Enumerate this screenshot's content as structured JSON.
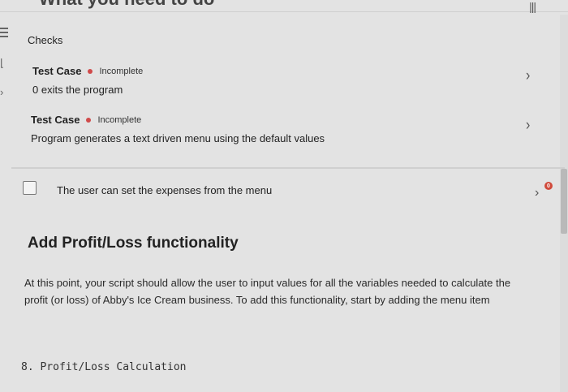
{
  "header": {
    "title": "What you need to do"
  },
  "checks": {
    "title": "Checks",
    "cases": [
      {
        "label": "Test Case",
        "status": "Incomplete",
        "description": "0 exits the program"
      },
      {
        "label": "Test Case",
        "status": "Incomplete",
        "description": "Program generates a text driven menu using the default values"
      }
    ]
  },
  "task": {
    "label": "The user can set the expenses from the menu",
    "badge": "0"
  },
  "section": {
    "title": "Add Profit/Loss functionality",
    "paragraph": "At this point, your script should allow the user to input values for all the variables needed to calculate the profit (or loss) of Abby's Ice Cream business. To add this functionality, start by adding the menu item"
  },
  "code": {
    "line": "8. Profit/Loss Calculation"
  },
  "colors": {
    "status_dot": "#d04a4a",
    "badge": "#d04a3b",
    "background": "#e3e3e3"
  }
}
